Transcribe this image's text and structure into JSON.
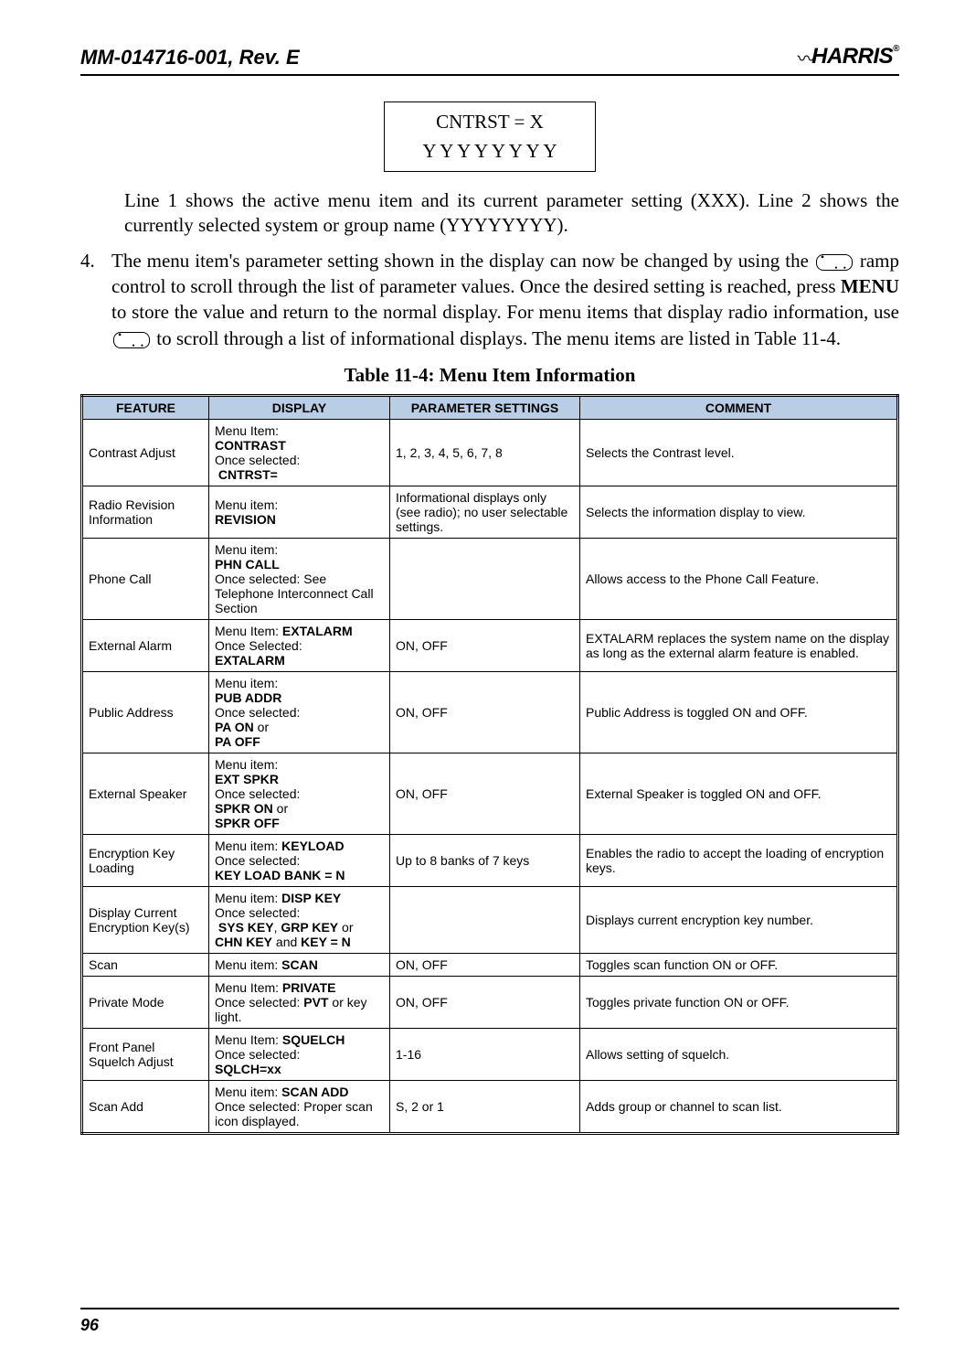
{
  "doc_id": "MM-014716-001, Rev. E",
  "logo_text": "HARRIS",
  "lcd": {
    "line1": "CNTRST  =  X",
    "line2": "Y Y Y Y Y Y Y Y"
  },
  "para_line": "Line 1 shows the active menu item and its current parameter setting (XXX). Line 2 shows the currently selected system or group name (YYYYYYYY).",
  "step4_num": "4.",
  "step4_a": "The menu item's parameter setting shown in the display can now be changed by using the ",
  "step4_b": " ramp control to scroll through the list of parameter values. Once the desired setting is reached, press ",
  "step4_menu": "MENU",
  "step4_c": " to store the value and return to the normal display. For menu items that display radio information, use ",
  "step4_d": " to scroll through a list of informational displays. The menu items are listed in Table 11-4.",
  "table_title": "Table 11-4: Menu Item Information",
  "headers": {
    "feature": "FEATURE",
    "display": "DISPLAY",
    "param": "PARAMETER SETTINGS",
    "comment": "COMMENT"
  },
  "rows": [
    {
      "feature": "Contrast Adjust",
      "display": "Menu Item:<br><b>CONTRAST</b><br>Once selected:<br>&nbsp;<b>CNTRST=</b>",
      "param": "1, 2, 3, 4, 5, 6, 7, 8",
      "comment": "Selects the Contrast level."
    },
    {
      "feature": "Radio Revision Information",
      "display": "Menu item:<br><b>REVISION</b>",
      "param": "Informational displays only (see radio); no user selectable settings.",
      "comment": "Selects the information display to view."
    },
    {
      "feature": "Phone Call",
      "display": "Menu item:<br><b>PHN CALL</b><br>Once selected:  See Telephone Interconnect Call Section",
      "param": "",
      "comment": "Allows access to the Phone Call Feature."
    },
    {
      "feature": "External Alarm",
      "display": "Menu Item:  <b>EXTALARM</b><br>Once Selected:<br><b>EXTALARM</b>",
      "param": "ON, OFF",
      "comment": "EXTALARM replaces the system name on the display as long as the external alarm feature is enabled."
    },
    {
      "feature": "Public Address",
      "display": "Menu item:<br><b>PUB ADDR</b><br>Once selected:<br><b>PA ON</b> or<br><b>PA OFF</b>",
      "param": "ON, OFF",
      "comment": "Public Address is toggled ON and OFF."
    },
    {
      "feature": "External Speaker",
      "display": "Menu item:<br><b>EXT SPKR</b><br>Once selected:<br><b>SPKR ON</b> or<br><b>SPKR OFF</b>",
      "param": "ON, OFF",
      "comment": "External Speaker is toggled ON and OFF."
    },
    {
      "feature": "Encryption Key Loading",
      "display": "Menu item: <b>KEYLOAD</b><br>Once selected:<br><b>KEY LOAD BANK = N</b>",
      "param": "Up to 8 banks of  7 keys",
      "comment": "Enables the radio to accept the loading of encryption keys."
    },
    {
      "feature": "Display Current Encryption Key(s)",
      "display": "Menu item: <b>DISP KEY</b><br>Once selected:<br>&nbsp;<b>SYS KEY</b>, <b>GRP KEY</b> or <b>CHN KEY</b> and <b>KEY = N</b>",
      "param": "",
      "comment": "Displays current encryption key number."
    },
    {
      "feature": "Scan",
      "display": "Menu item: <b>SCAN</b>",
      "param": "ON, OFF",
      "comment": "Toggles scan function ON or OFF."
    },
    {
      "feature": "Private Mode",
      "display": "Menu Item: <b>PRIVATE</b><br>Once selected: <b>PVT</b> or key light.",
      "param": "ON, OFF",
      "comment": "Toggles private function ON or OFF."
    },
    {
      "feature": "Front Panel Squelch Adjust",
      "display": "Menu Item: <b>SQUELCH</b><br>Once selected:<br><b>SQLCH=xx</b>",
      "param": "1-16",
      "comment": "Allows setting of squelch."
    },
    {
      "feature": "Scan Add",
      "display": "Menu item: <b>SCAN ADD</b><br>Once selected: Proper scan icon displayed.",
      "param": "S, 2 or 1",
      "comment": "Adds group or channel to scan list."
    }
  ],
  "page_number": "96"
}
